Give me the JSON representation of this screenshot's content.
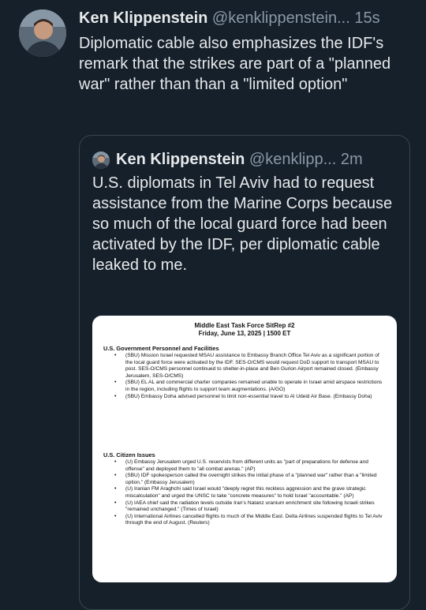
{
  "post": {
    "author_name": "Ken Klippenstein",
    "author_handle": "@kenklippenstein...",
    "separator": "",
    "time": "15s",
    "text": "Diplomatic cable also emphasizes the IDF's remark that the strikes are part of a \"planned war\" rather than than a \"limited option\""
  },
  "quote": {
    "author_name": "Ken Klippenstein",
    "author_handle": "@kenklipp...",
    "time": "2m",
    "text": "U.S. diplomats in Tel Aviv had to request assistance from the Marine Corps because so much of the local guard force had been activated by the IDF, per diplomatic cable leaked to me."
  },
  "document": {
    "title": "Middle East Task Force SitRep #2",
    "subtitle": "Friday, June 13, 2025 | 1500 ET",
    "section1_heading": "U.S. Government Personnel and Facilities",
    "section1_items": [
      "(SBU) Mission Israel requested MSAU assistance to Embassy Branch Office Tel Aviv as a significant portion of the local guard force were activated by the IDF. SES-O/CMS would request DoD support to transport MSAU to post. SES-O/CMS personnel continued to shelter-in-place and Ben Gurion Airport remained closed. (Embassy Jerusalem, SES-O/CMS)",
      "(SBU) EL AL and commercial charter companies remained unable to operate in Israel amid airspace restrictions in the region, including flights to support team augmentations. (A/GO)",
      "(SBU) Embassy Doha advised personnel to limit non-essential travel to Al Udeid Air Base. (Embassy Doha)"
    ],
    "section2_heading": "U.S. Citizen Issues",
    "section2_items": [
      "(U) Embassy Jerusalem urged U.S. reservists from different units as \"part of preparations for defense and offense\" and deployed them to \"all combat arenas.\" (AP)",
      "(SBU) IDF spokesperson called the overnight strikes the initial phase of a \"planned war\" rather than a \"limited option.\" (Embassy Jerusalem)",
      "(U) Iranian FM Araghchi said Israel would \"deeply regret this reckless aggression and the grave strategic miscalculation\" and urged the UNSC to take \"concrete measures\" to hold Israel \"accountable.\" (AP)",
      "(U) IAEA chief said the radiation levels outside Iran's Natanz uranium enrichment site following Israeli strikes \"remained unchanged.\" (Times of Israel)",
      "(U) International Airlines cancelled flights to much of the Middle East. Delta Airlines suspended flights to Tel Aviv through the end of August. (Reuters)"
    ]
  },
  "colors": {
    "background": "#15202b",
    "text": "#e7e9ea",
    "secondary": "#8b98a5",
    "border": "#38444d"
  }
}
